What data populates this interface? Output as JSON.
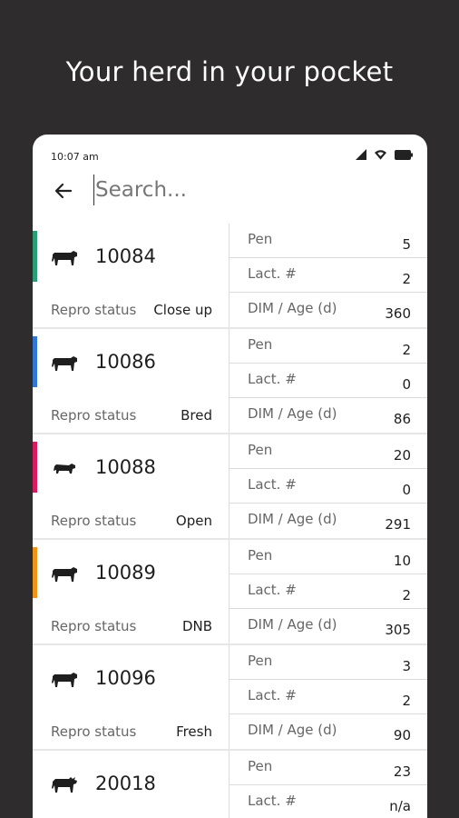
{
  "headline": "Your herd in your pocket",
  "status_bar": {
    "time": "10:07 am"
  },
  "search": {
    "placeholder": "Search..."
  },
  "labels": {
    "repro_status": "Repro status",
    "pen": "Pen",
    "lact": "Lact. #",
    "dim_age": "DIM / Age (d)"
  },
  "animals": [
    {
      "id": "10084",
      "repro": "Close up",
      "pen": "5",
      "lact": "2",
      "dim": "360",
      "stripe_color": "#2a9d75",
      "icon": "cow-icon"
    },
    {
      "id": "10086",
      "repro": "Bred",
      "pen": "2",
      "lact": "0",
      "dim": "86",
      "stripe_color": "#2f78d8",
      "icon": "cow-icon"
    },
    {
      "id": "10088",
      "repro": "Open",
      "pen": "20",
      "lact": "0",
      "dim": "291",
      "stripe_color": "#d81b5f",
      "icon": "calf-icon"
    },
    {
      "id": "10089",
      "repro": "DNB",
      "pen": "10",
      "lact": "2",
      "dim": "305",
      "stripe_color": "#f0941a",
      "icon": "cow-icon"
    },
    {
      "id": "10096",
      "repro": "Fresh",
      "pen": "3",
      "lact": "2",
      "dim": "90",
      "stripe_color": "",
      "icon": "cow-icon"
    },
    {
      "id": "20018",
      "repro": "",
      "pen": "23",
      "lact": "n/a",
      "dim": "",
      "stripe_color": "",
      "icon": "bull-icon"
    }
  ]
}
